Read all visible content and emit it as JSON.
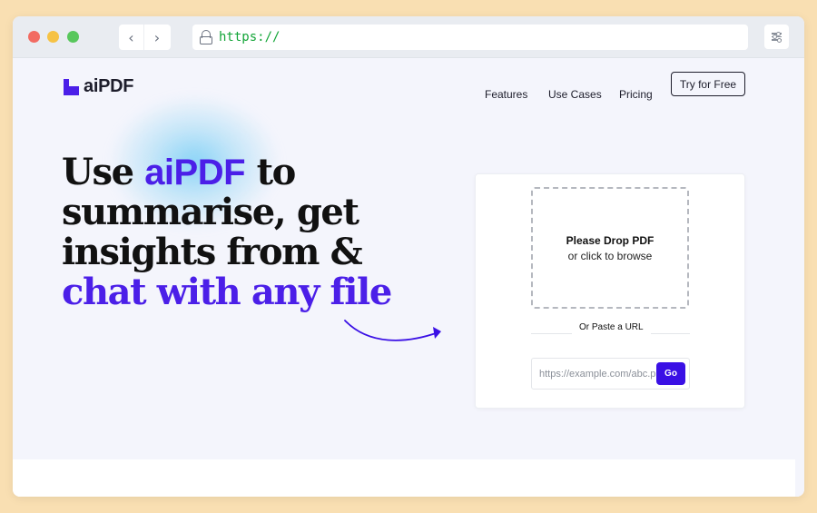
{
  "browser": {
    "url": "https://",
    "back_icon": "chevron-left-icon",
    "forward_icon": "chevron-right-icon",
    "lock_icon": "lock-icon",
    "settings_icon": "sliders-icon"
  },
  "nav": {
    "logo_text": "aiPDF",
    "features": "Features",
    "use_cases": "Use Cases",
    "pricing": "Pricing",
    "try_free": "Try for Free"
  },
  "hero": {
    "line1_a": "Use ",
    "brand": "aiPDF",
    "line1_b": " to",
    "line2": "summarise, get",
    "line3": "insights from &",
    "line4": "chat with any file"
  },
  "upload": {
    "drop_title": "Please Drop PDF",
    "drop_sub": "or click to browse",
    "or_paste": "Or Paste a URL",
    "url_placeholder": "https://example.com/abc.pdf",
    "go_label": "Go"
  },
  "colors": {
    "brand": "#4b1fe8",
    "background": "#f9dfb2",
    "url_text": "#13a538"
  }
}
